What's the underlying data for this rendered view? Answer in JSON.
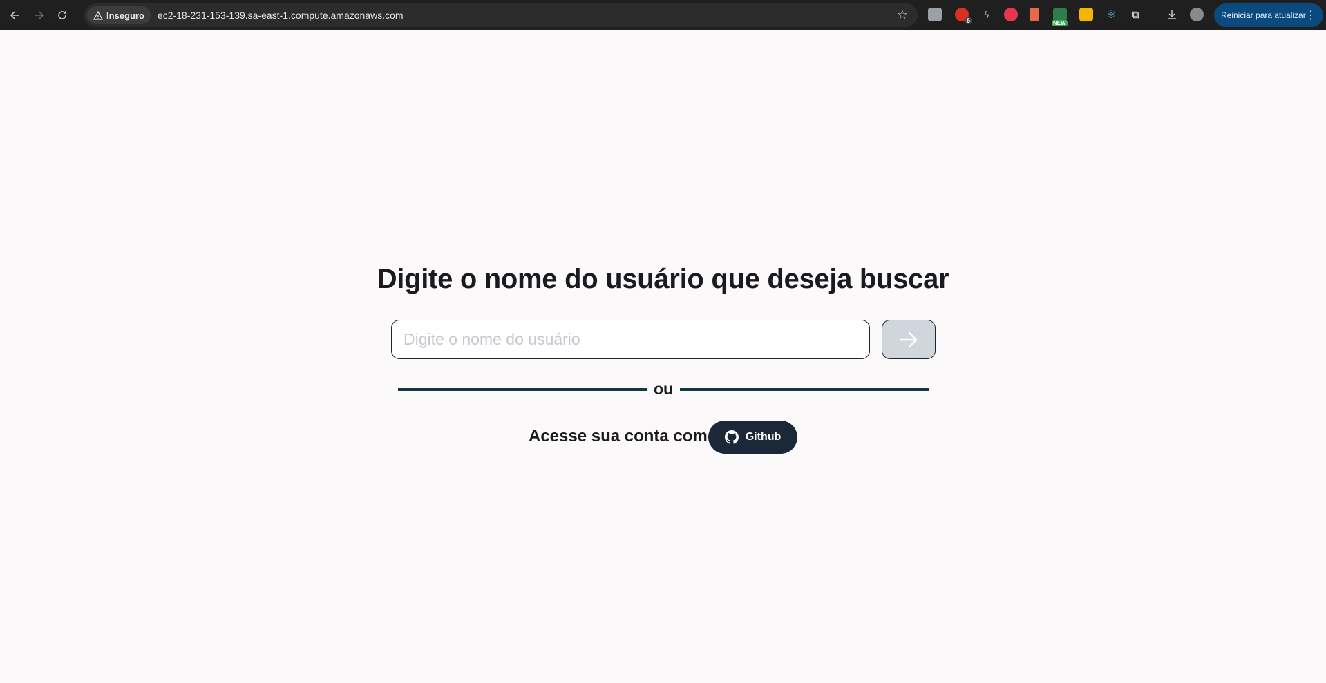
{
  "browser": {
    "security_label": "Inseguro",
    "url": "ec2-18-231-153-139.sa-east-1.compute.amazonaws.com",
    "restart_label": "Reiniciar para atualizar",
    "extension_badges": {
      "ext2": "5",
      "ext6": "NEW"
    }
  },
  "page": {
    "title": "Digite o nome do usuário que deseja buscar",
    "search_placeholder": "Digite o nome do usuário",
    "divider_text": "ou",
    "login_label": "Acesse sua conta com",
    "github_label": "Github"
  },
  "colors": {
    "background": "#fbf9f9",
    "text": "#1b1b1f",
    "divider": "#12383f",
    "github_button": "#1b2838",
    "submit_button": "#d1d5dc"
  }
}
